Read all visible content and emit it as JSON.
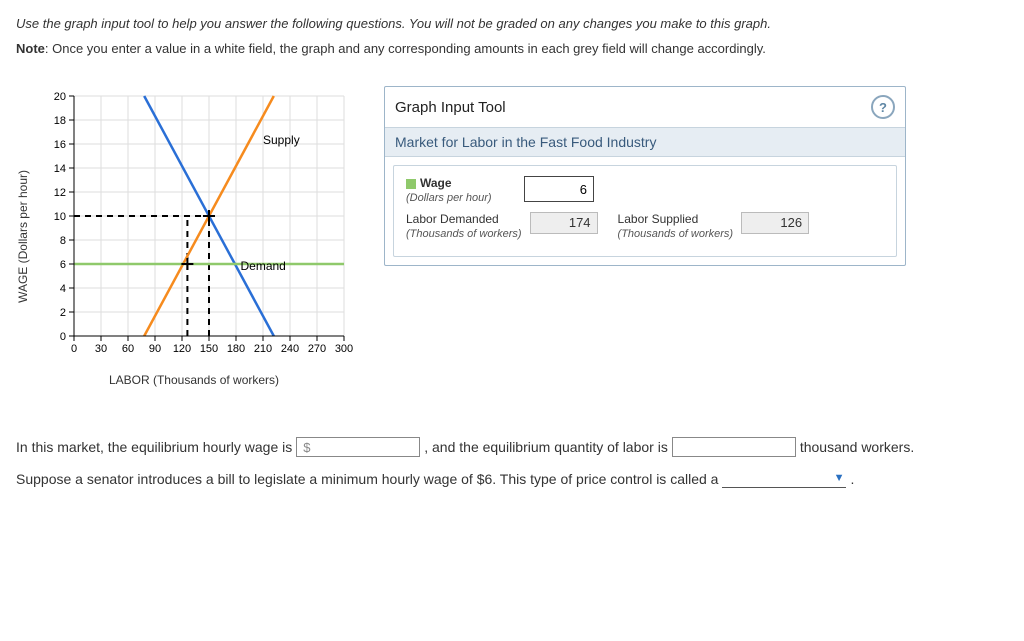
{
  "intro": {
    "main": "Use the graph input tool to help you answer the following questions. You will not be graded on any changes you make to this graph.",
    "note_bold": "Note",
    "note_rest": ": Once you enter a value in a white field, the graph and any corresponding amounts in each grey field will change accordingly."
  },
  "chart_data": {
    "type": "line",
    "title": "",
    "xlabel": "LABOR (Thousands of workers)",
    "ylabel": "WAGE (Dollars per hour)",
    "xlim": [
      0,
      300
    ],
    "ylim": [
      0,
      20
    ],
    "xticks": [
      0,
      30,
      60,
      90,
      120,
      150,
      180,
      210,
      240,
      270,
      300
    ],
    "yticks": [
      0,
      2,
      4,
      6,
      8,
      10,
      12,
      14,
      16,
      18,
      20
    ],
    "series": [
      {
        "name": "Supply",
        "color": "#f68b1e",
        "points": [
          [
            78,
            0
          ],
          [
            222,
            20
          ]
        ]
      },
      {
        "name": "Demand",
        "color": "#2a6fd6",
        "points": [
          [
            78,
            20
          ],
          [
            222,
            0
          ]
        ]
      },
      {
        "name": "WageLine",
        "color": "#8fc96b",
        "points": [
          [
            0,
            6
          ],
          [
            300,
            6
          ]
        ]
      }
    ],
    "reference_lines": [
      {
        "axis": "y",
        "value": 10,
        "from_x": 0,
        "to_x": 150
      },
      {
        "axis": "x",
        "value": 126,
        "from_y": 0,
        "to_y": 10
      },
      {
        "axis": "x",
        "value": 150,
        "from_y": 0,
        "to_y": 10
      }
    ],
    "markers": [
      {
        "x": 126,
        "y": 6
      },
      {
        "x": 150,
        "y": 10
      }
    ]
  },
  "tool": {
    "title": "Graph Input Tool",
    "subtitle": "Market for Labor in the Fast Food Industry",
    "wage_label": "Wage",
    "wage_sub": "(Dollars per hour)",
    "wage_value": "6",
    "demand_label": "Labor Demanded",
    "demand_sub": "(Thousands of workers)",
    "demand_value": "174",
    "supply_label": "Labor Supplied",
    "supply_sub": "(Thousands of workers)",
    "supply_value": "126"
  },
  "q1": {
    "pre": "In this market, the equilibrium hourly wage is",
    "mid": ", and the equilibrium quantity of labor is",
    "post": "thousand workers."
  },
  "q2": {
    "pre": "Suppose a senator introduces a bill to legislate a minimum hourly wage of $6. This type of price control is called a",
    "post": "."
  }
}
